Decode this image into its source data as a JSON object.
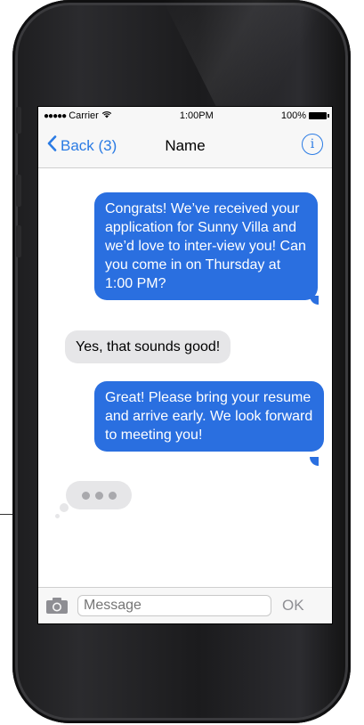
{
  "status_bar": {
    "signal": "●●●●●",
    "carrier": "Carrier",
    "time": "1:00PM",
    "battery_percent": "100%"
  },
  "nav": {
    "back_label": "Back (3)",
    "title": "Name",
    "info_glyph": "i"
  },
  "messages": [
    {
      "direction": "out",
      "text": "Congrats! We’ve received your application for Sunny Villa and we’d love to inter-view you! Can you come in on Thursday at 1:00 PM?"
    },
    {
      "direction": "in",
      "text": "Yes, that sounds good!"
    },
    {
      "direction": "out",
      "text": "Great! Please bring your resume and arrive early. We look forward to meeting you!"
    }
  ],
  "input_bar": {
    "placeholder": "Message",
    "send_label": "OK"
  },
  "colors": {
    "accent": "#2a7be4",
    "outgoing_bubble": "#2a6fe0",
    "incoming_bubble": "#e6e6e8"
  },
  "icons": [
    "wifi-icon",
    "battery-icon",
    "chevron-left-icon",
    "info-icon",
    "camera-icon",
    "typing-indicator-icon"
  ]
}
